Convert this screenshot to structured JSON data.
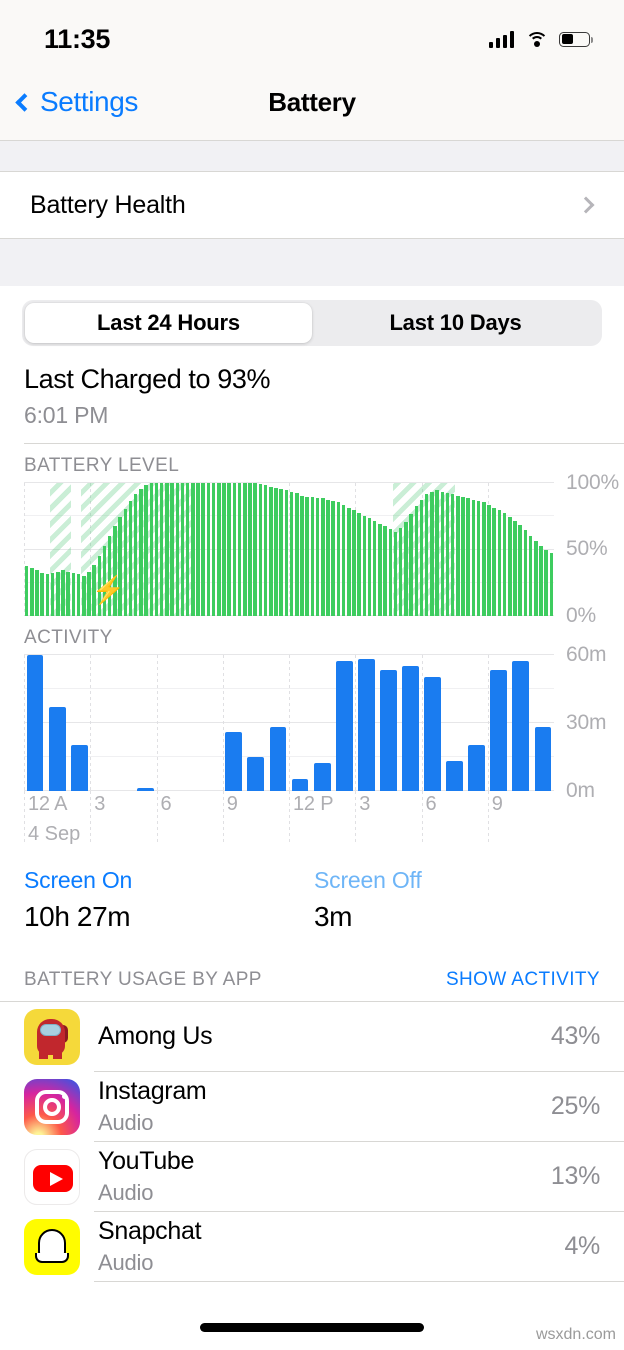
{
  "status_bar": {
    "time": "11:35",
    "signal_icon": "cellular-bars-icon",
    "wifi_icon": "wifi-icon",
    "battery_icon": "battery-icon",
    "battery_fill_percent": 45
  },
  "nav": {
    "back_label": "Settings",
    "title": "Battery",
    "back_icon": "chevron-left-icon"
  },
  "battery_health": {
    "label": "Battery Health",
    "chevron_icon": "chevron-right-icon"
  },
  "segmented": {
    "options": [
      "Last 24 Hours",
      "Last 10 Days"
    ],
    "selected_index": 0
  },
  "last_charged": {
    "title": "Last Charged to 93%",
    "time": "6:01 PM",
    "percent": 93
  },
  "screen_stats": {
    "on_label": "Screen On",
    "on_value": "10h 27m",
    "off_label": "Screen Off",
    "off_value": "3m"
  },
  "usage_section": {
    "header": "BATTERY USAGE BY APP",
    "action": "SHOW ACTIVITY"
  },
  "apps": [
    {
      "name": "Among Us",
      "subtitle": "",
      "percent": "43%",
      "icon": "among-us-icon"
    },
    {
      "name": "Instagram",
      "subtitle": "Audio",
      "percent": "25%",
      "icon": "instagram-icon"
    },
    {
      "name": "YouTube",
      "subtitle": "Audio",
      "percent": "13%",
      "icon": "youtube-icon"
    },
    {
      "name": "Snapchat",
      "subtitle": "Audio",
      "percent": "4%",
      "icon": "snapchat-icon"
    }
  ],
  "watermark": "wsxdn.com",
  "colors": {
    "accent_blue": "#0a7cff",
    "battery_green": "#3ecc5f",
    "activity_blue": "#1a7cf0",
    "muted_gray": "#8e8e93",
    "axis_gray": "#aeaeb2"
  },
  "chart_data": [
    {
      "type": "bar",
      "title": "BATTERY LEVEL",
      "ylabel": "",
      "xlabel": "",
      "ylim": [
        0,
        100
      ],
      "yticks": [
        0,
        50,
        100
      ],
      "ytick_labels": [
        "0%",
        "50%",
        "100%"
      ],
      "grid": true,
      "bar_color": "#3ecc5f",
      "charging_bands": [
        {
          "start_index": 5,
          "end_index": 8
        },
        {
          "start_index": 11,
          "end_index": 32
        },
        {
          "start_index": 71,
          "end_index": 82
        }
      ],
      "charging_bolt_at_index": 13,
      "values": [
        37,
        36,
        34,
        32,
        31,
        32,
        33,
        34,
        33,
        32,
        31,
        30,
        33,
        38,
        45,
        52,
        60,
        67,
        74,
        80,
        86,
        91,
        95,
        98,
        100,
        100,
        100,
        100,
        100,
        100,
        100,
        100,
        100,
        100,
        100,
        100,
        100,
        100,
        100,
        100,
        100,
        100,
        100,
        100,
        100,
        99,
        98,
        97,
        96,
        95,
        94,
        93,
        92,
        90,
        89,
        89,
        88,
        88,
        87,
        86,
        85,
        83,
        81,
        79,
        77,
        75,
        73,
        71,
        69,
        67,
        65,
        63,
        66,
        70,
        76,
        82,
        87,
        91,
        93,
        94,
        93,
        92,
        91,
        90,
        89,
        88,
        87,
        86,
        85,
        83,
        81,
        79,
        77,
        74,
        71,
        68,
        64,
        60,
        56,
        52,
        49,
        47
      ]
    },
    {
      "type": "bar",
      "title": "ACTIVITY",
      "ylabel": "",
      "xlabel": "",
      "ylim": [
        0,
        60
      ],
      "yticks": [
        0,
        30,
        60
      ],
      "ytick_labels": [
        "0m",
        "30m",
        "60m"
      ],
      "grid": true,
      "bar_color": "#1a7cf0",
      "x_tick_labels": [
        "12 A",
        "3",
        "6",
        "9",
        "12 P",
        "3",
        "6",
        "9"
      ],
      "x_date_label": "4 Sep",
      "categories": [
        "12 A",
        "1 A",
        "2 A",
        "3 A",
        "4 A",
        "5 A",
        "6 A",
        "7 A",
        "8 A",
        "9 A",
        "10 A",
        "11 A",
        "12 P",
        "1 P",
        "2 P",
        "3 P",
        "4 P",
        "5 P",
        "6 P",
        "7 P",
        "8 P",
        "9 P",
        "10 P",
        "11 P"
      ],
      "values": [
        60,
        37,
        20,
        0,
        0,
        1,
        0,
        0,
        0,
        26,
        15,
        28,
        5,
        12,
        57,
        58,
        53,
        55,
        50,
        13,
        20,
        53,
        57,
        28
      ]
    }
  ]
}
